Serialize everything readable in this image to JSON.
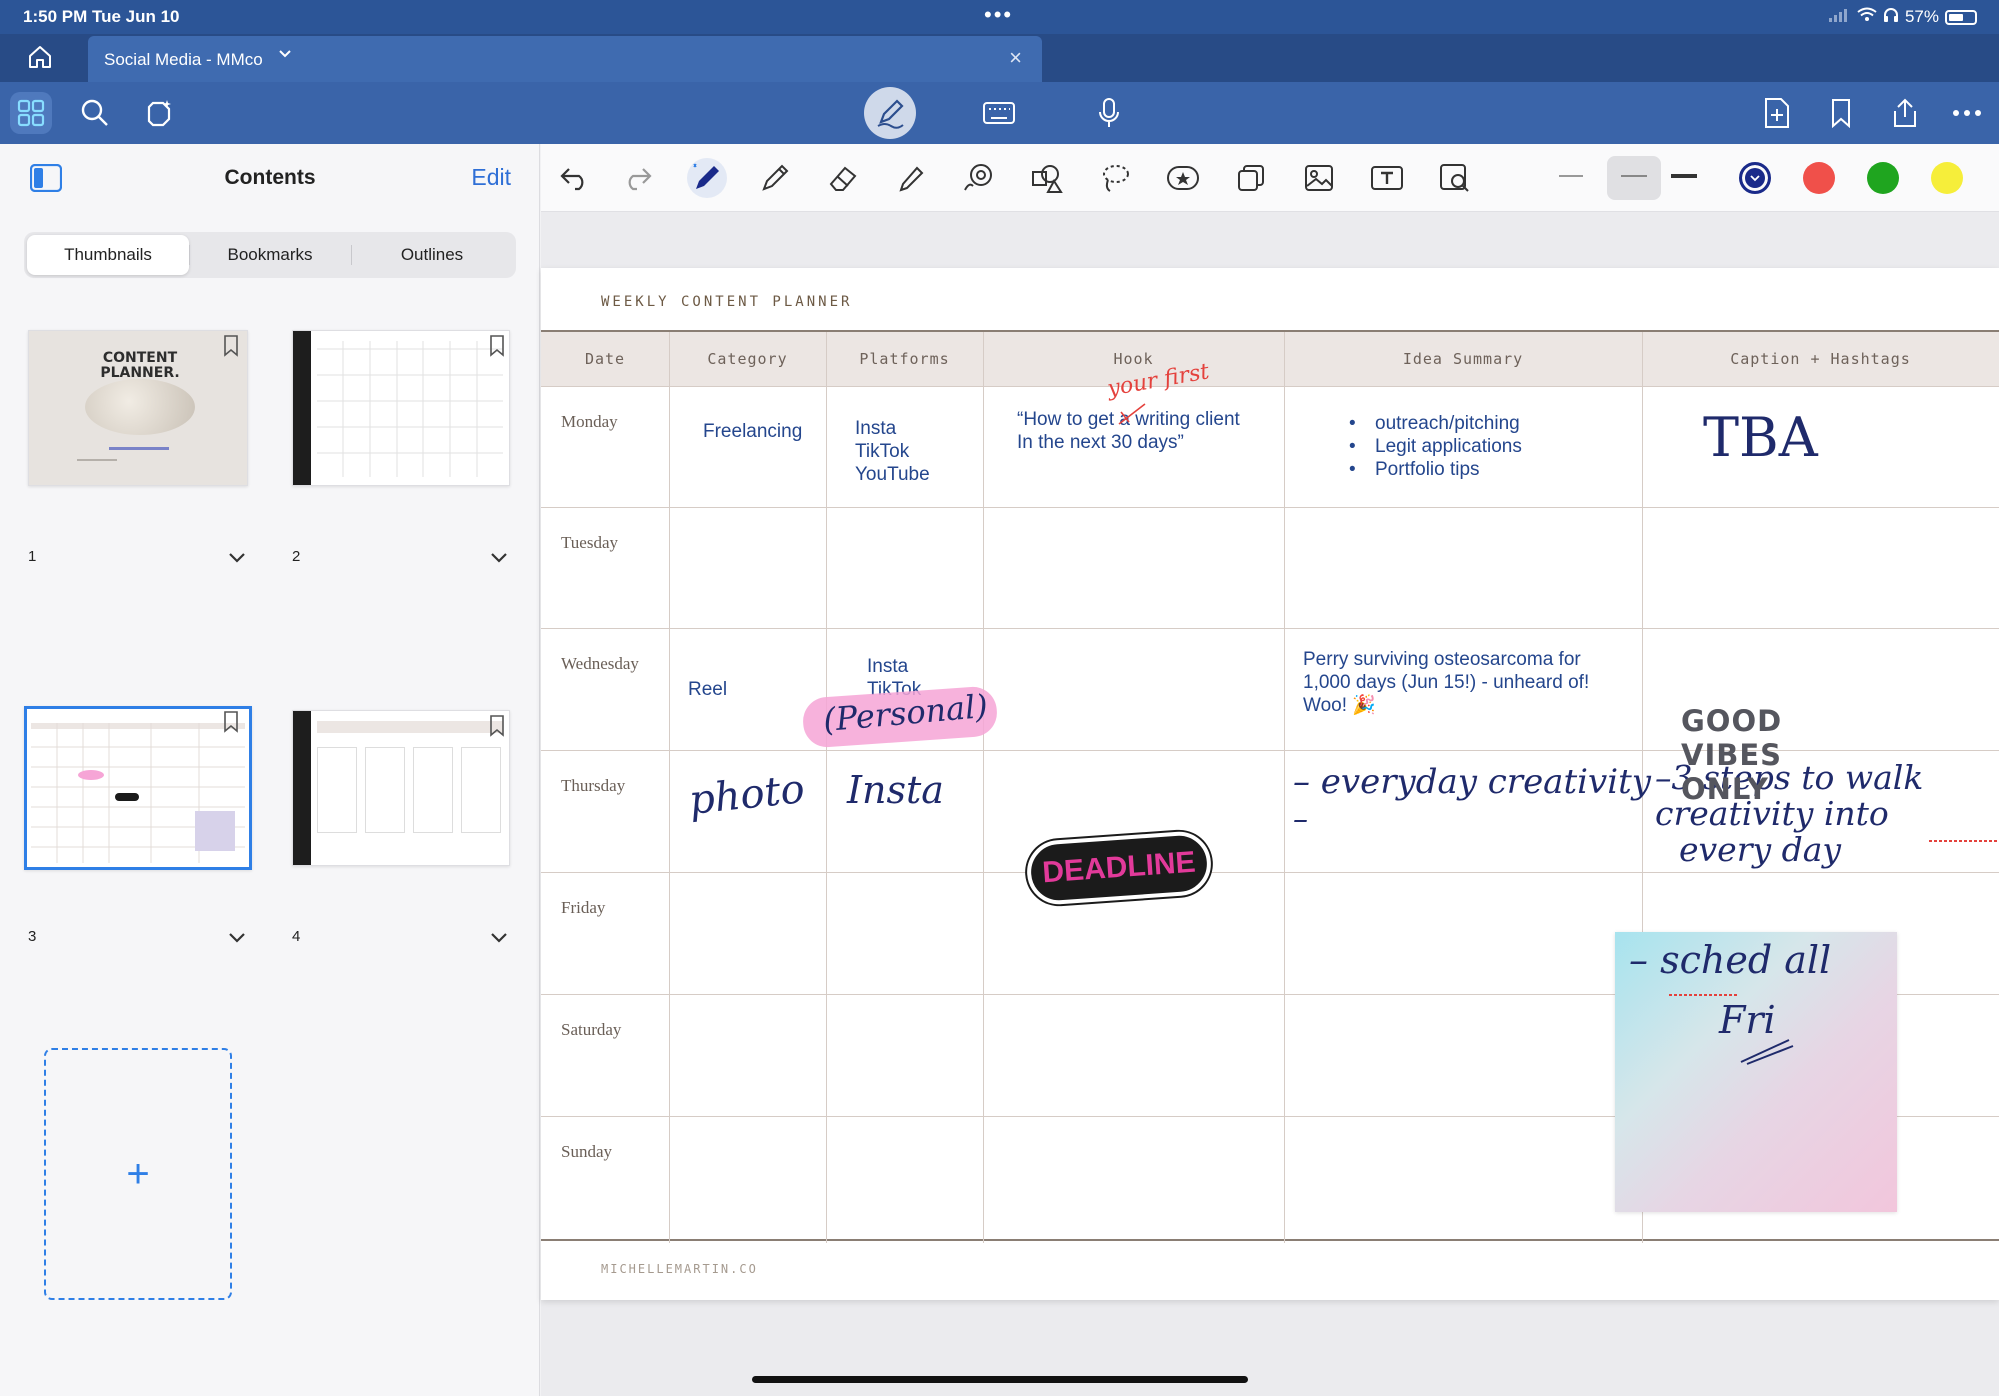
{
  "status": {
    "time": "1:50 PM  Tue Jun 10",
    "battery": "57%"
  },
  "tab": {
    "title": "Social Media - MMco"
  },
  "sidebar": {
    "title": "Contents",
    "edit_label": "Edit",
    "segments": [
      "Thumbnails",
      "Bookmarks",
      "Outlines"
    ],
    "thumb1_heading": "CONTENT PLANNER.",
    "pages": [
      "1",
      "2",
      "3",
      "4"
    ],
    "add_label": "+"
  },
  "colors": {
    "chrome": "#2c5597",
    "accent": "#2f7fe6",
    "palette": [
      "#1a2a8a",
      "#f0504a",
      "#1fa51f",
      "#f6ee3a"
    ]
  },
  "planner": {
    "title": "WEEKLY CONTENT PLANNER",
    "footer": "MICHELLEMARTIN.CO",
    "columns": [
      "Date",
      "Category",
      "Platforms",
      "Hook",
      "Idea Summary",
      "Caption + Hashtags"
    ],
    "days": [
      "Monday",
      "Tuesday",
      "Wednesday",
      "Thursday",
      "Friday",
      "Saturday",
      "Sunday"
    ],
    "monday": {
      "category": "Freelancing",
      "platforms": [
        "Insta",
        "TikTok",
        "YouTube"
      ],
      "hook_line1": "“How to get a writing client",
      "hook_line2": "In the next 30 days”",
      "hook_annotation": "your first",
      "idea_bullets": [
        "outreach/pitching",
        "Legit applications",
        "Portfolio tips"
      ],
      "caption": "TBA"
    },
    "wednesday": {
      "category": "Reel",
      "platforms": [
        "Insta",
        "TikTok"
      ],
      "platform_note": "(Personal)",
      "idea_line1": "Perry surviving osteosarcoma for",
      "idea_line2": "1,000 days (Jun 15!) - unheard of!",
      "idea_line3": "Woo! 🎉",
      "sticker_lines": [
        "GOOD",
        "VIBES",
        "ONLY"
      ]
    },
    "thursday": {
      "category": "photo",
      "platforms": "Insta",
      "hook_sticker": "DEADLINE",
      "idea": "– everyday creativity",
      "idea_dash": "–",
      "caption_line1": "–3 steps to walk",
      "caption_line2": "creativity into",
      "caption_line3": "every day"
    },
    "sticky_note": {
      "line1": "– sched all",
      "line2": "Fri"
    }
  }
}
